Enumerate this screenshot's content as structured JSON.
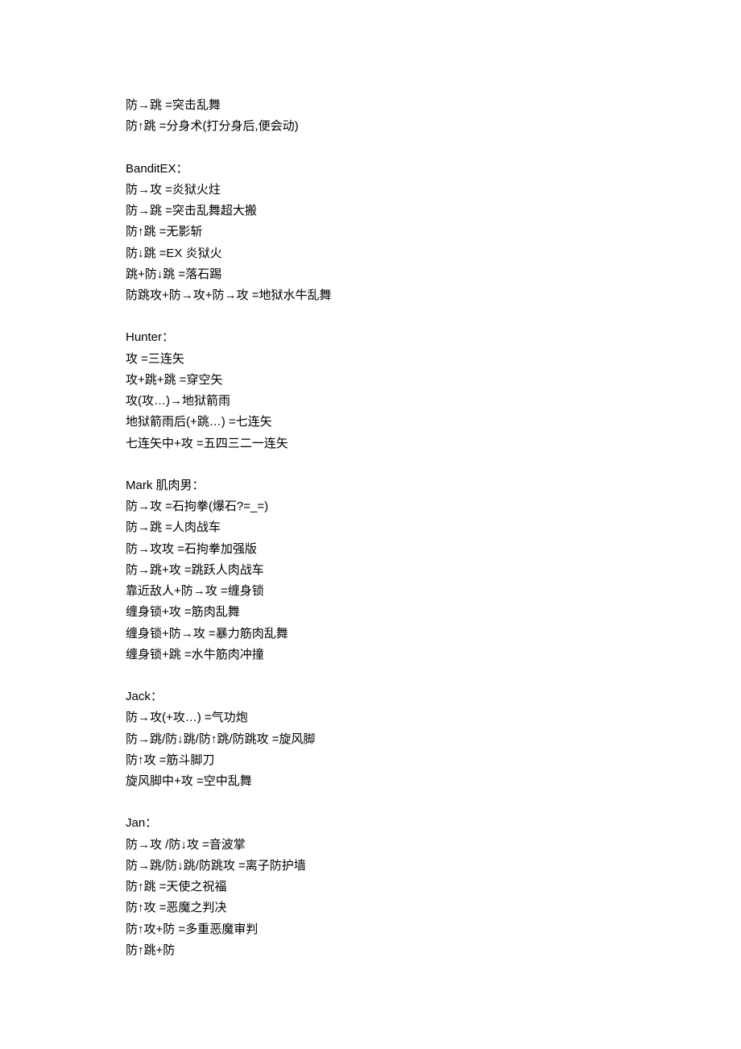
{
  "sections": [
    {
      "heading": "",
      "moves": [
        "防→跳 =突击乱舞",
        "防↑跳 =分身术(打分身后,便会动)"
      ]
    },
    {
      "heading": "BanditEX：",
      "moves": [
        "防→攻 =炎狱火炷",
        "防→跳 =突击乱舞超大搬",
        "防↑跳 =无影斩",
        "防↓跳 =EX 炎狱火",
        "跳+防↓跳 =落石踢",
        "防跳攻+防→攻+防→攻 =地狱水牛乱舞"
      ]
    },
    {
      "heading": "Hunter：",
      "moves": [
        "攻 =三连矢",
        "攻+跳+跳 =穿空矢",
        "攻(攻…)→地狱箭雨",
        "地狱箭雨后(+跳…) =七连矢",
        "七连矢中+攻 =五四三二一连矢"
      ]
    },
    {
      "heading": "Mark 肌肉男：",
      "moves": [
        "防→攻 =石拘拳(爆石?=_=)",
        "防→跳 =人肉战车",
        "防→攻攻 =石拘拳加强版",
        "防→跳+攻 =跳跃人肉战车",
        "靠近敌人+防→攻 =缠身锁",
        "缠身锁+攻 =筋肉乱舞",
        "缠身锁+防→攻 =暴力筋肉乱舞",
        "缠身锁+跳 =水牛筋肉冲撞"
      ]
    },
    {
      "heading": "Jack：",
      "moves": [
        "防→攻(+攻…) =气功炮",
        "防→跳/防↓跳/防↑跳/防跳攻 =旋风脚",
        "防↑攻 =筋斗脚刀",
        "旋风脚中+攻 =空中乱舞"
      ]
    },
    {
      "heading": "Jan：",
      "moves": [
        "防→攻 /防↓攻 =音波掌",
        "防→跳/防↓跳/防跳攻 =离子防护墙",
        "防↑跳 =天使之祝福",
        "防↑攻 =恶魔之判决",
        "防↑攻+防 =多重恶魔审判",
        "防↑跳+防"
      ]
    }
  ]
}
